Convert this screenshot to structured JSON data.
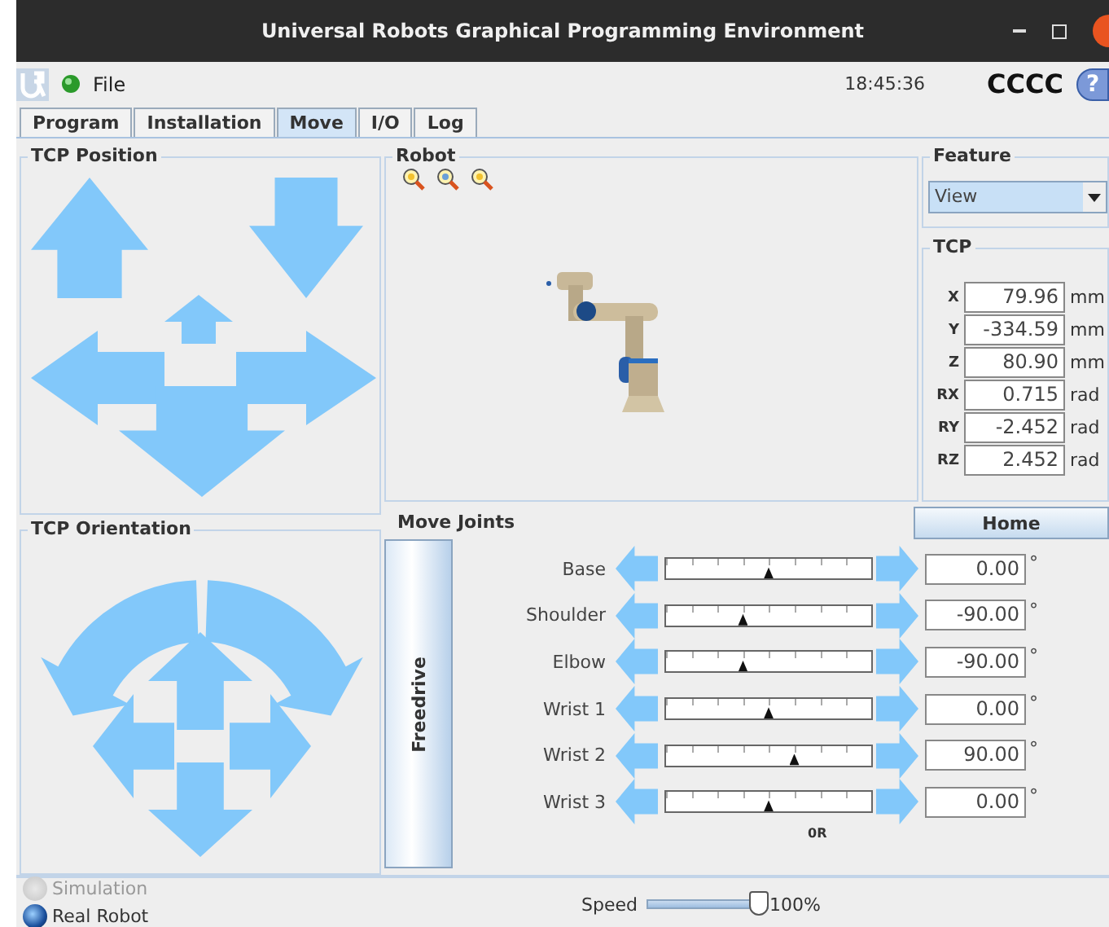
{
  "window": {
    "title": "Universal Robots Graphical Programming Environment"
  },
  "menu": {
    "file": "File",
    "time": "18:45:36",
    "robot_name": "CCCC",
    "help": "?"
  },
  "tabs": [
    {
      "label": "Program",
      "selected": false
    },
    {
      "label": "Installation",
      "selected": false
    },
    {
      "label": "Move",
      "selected": true
    },
    {
      "label": "I/O",
      "selected": false
    },
    {
      "label": "Log",
      "selected": false
    }
  ],
  "tcp_position": {
    "title": "TCP Position"
  },
  "tcp_orientation": {
    "title": "TCP Orientation"
  },
  "robot": {
    "title": "Robot"
  },
  "feature": {
    "title": "Feature",
    "value": "View"
  },
  "tcp": {
    "title": "TCP",
    "fields": [
      {
        "label": "X",
        "value": "79.96",
        "unit": "mm"
      },
      {
        "label": "Y",
        "value": "-334.59",
        "unit": "mm"
      },
      {
        "label": "Z",
        "value": "80.90",
        "unit": "mm"
      },
      {
        "label": "RX",
        "value": "0.715",
        "unit": "rad"
      },
      {
        "label": "RY",
        "value": "-2.452",
        "unit": "rad"
      },
      {
        "label": "RZ",
        "value": "2.452",
        "unit": "rad"
      }
    ]
  },
  "move_joints": {
    "title": "Move Joints",
    "home": "Home",
    "freedrive": "Freedrive",
    "scale_label": "0R",
    "joints": [
      {
        "name": "Base",
        "level": 0.5,
        "value": "0.00",
        "unit": "°"
      },
      {
        "name": "Shoulder",
        "level": 0.375,
        "value": "-90.00",
        "unit": "°"
      },
      {
        "name": "Elbow",
        "level": 0.375,
        "value": "-90.00",
        "unit": "°"
      },
      {
        "name": "Wrist 1",
        "level": 0.5,
        "value": "0.00",
        "unit": "°"
      },
      {
        "name": "Wrist 2",
        "level": 0.625,
        "value": "90.00",
        "unit": "°"
      },
      {
        "name": "Wrist 3",
        "level": 0.5,
        "value": "0.00",
        "unit": "°"
      }
    ]
  },
  "mode": [
    {
      "label": "Simulation",
      "selected": false
    },
    {
      "label": "Real Robot",
      "selected": true
    }
  ],
  "speed": {
    "label": "Speed",
    "level": 1,
    "reading": "100%"
  }
}
